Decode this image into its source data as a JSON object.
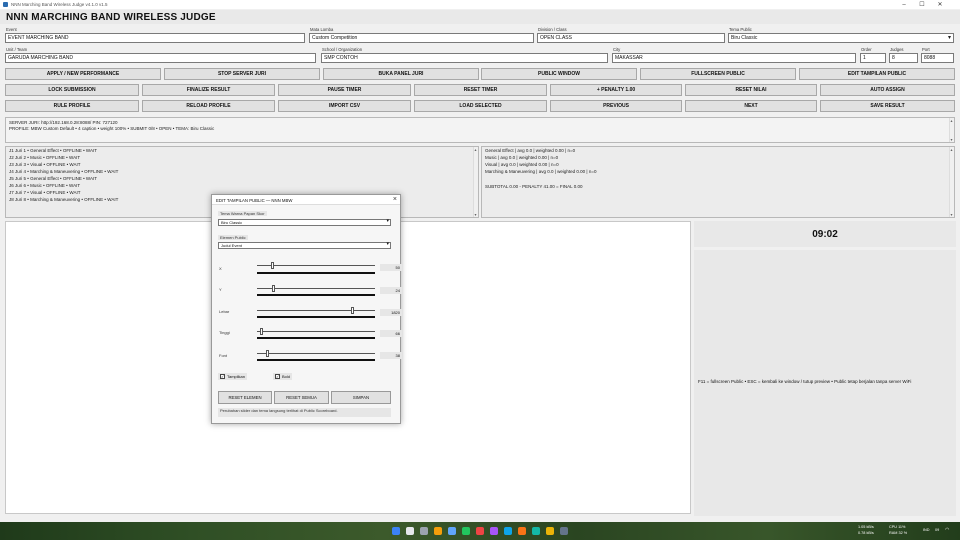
{
  "window": {
    "title": "NNN Marching Band Wireless Judge v4.1.0 v1.5"
  },
  "app_title": "NNN MARCHING BAND WIRELESS JUDGE",
  "form": {
    "event_label": "Event",
    "event_value": "EVENT MARCHING BAND",
    "mata_label": "Mata Lomba",
    "mata_value": "Custom Competition",
    "division_label": "Division / Class",
    "division_value": "OPEN CLASS",
    "tema_label": "Tema Public",
    "tema_value": "Biru Classic",
    "unit_label": "Unit / Team",
    "unit_value": "GARUDA MARCHING BAND",
    "school_label": "School / Organization",
    "school_value": "SMP CONTOH",
    "city_label": "City",
    "city_value": "MAKASSAR",
    "order_label": "Order",
    "order_value": "1",
    "judges_label": "Judges",
    "judges_value": "8",
    "port_label": "Port",
    "port_value": "8088"
  },
  "buttons": {
    "row1": [
      "APPLY / NEW PERFORMANCE",
      "STOP SERVER JURI",
      "BUKA PANEL JURI",
      "PUBLIC WINDOW",
      "FULLSCREEN PUBLIC",
      "EDIT TAMPILAN PUBLIC"
    ],
    "row2": [
      "LOCK SUBMISSION",
      "FINALIZE RESULT",
      "PAUSE TIMER",
      "RESET TIMER",
      "+ PENALTY 1.00",
      "RESET NILAI",
      "AUTO ASSIGN"
    ],
    "row3": [
      "RULE PROFILE",
      "RELOAD PROFILE",
      "IMPORT CSV",
      "LOAD SELECTED",
      "PREVIOUS",
      "NEXT",
      "SAVE RESULT"
    ]
  },
  "status": {
    "line1": "SERVER JURI: http://192.168.0.28:8088/    PIN: 727120",
    "line2": "PROFILE: MBW Custom Default • 4 caption • weight 100%   •   SUBMIT 0/8   •   OPEN   •   TEMA: Biru Classic"
  },
  "judges": [
    "J1  Juri 1  •  General Effect  •  OFFLINE  •  WAIT",
    "J2  Juri 2  •  Music  •  OFFLINE  •  WAIT",
    "J3  Juri 3  •  Visual  •  OFFLINE  •  WAIT",
    "J4  Juri 4  •  Marching & Maneuvering  •  OFFLINE  •  WAIT",
    "J5  Juri 5  •  General Effect  •  OFFLINE  •  WAIT",
    "J6  Juri 6  •  Music  •  OFFLINE  •  WAIT",
    "J7  Juri 7  •  Visual  •  OFFLINE  •  WAIT",
    "J8  Juri 8  •  Marching & Maneuvering  •  OFFLINE  •  WAIT"
  ],
  "scores": [
    "General Effect  |  avg 0.0  |  weighted 0.00  |  n=0",
    "Music  |  avg 0.0  |  weighted 0.00  |  n=0",
    "Visual  |  avg 0.0  |  weighted 0.00  |  n=0",
    "Marching & Maneuvering  |  avg 0.0  |  weighted 0.00  |  n=0",
    "",
    "SUBTOTAL 0.00   -   PENALTY 41.00   =   FINAL 0.00"
  ],
  "timer": "09:02",
  "hint": "F11 = fullscreen Public  •  ESC = kembali ke window / tutup preview  •  Public tetap berjalan tanpa server WiFi",
  "dialog": {
    "title": "EDIT TAMPILAN PUBLIC — NNN MBW",
    "theme_label": "Tema Warna Papan Skor",
    "theme_value": "Biru Classic",
    "element_label": "Elemen Public",
    "element_value": "Judul Event",
    "sliders": [
      {
        "label": "X",
        "value": "50",
        "fraction": 0.12
      },
      {
        "label": "Y",
        "value": "24",
        "fraction": 0.13
      },
      {
        "label": "Lebar",
        "value": "1820",
        "fraction": 0.82
      },
      {
        "label": "Tinggi",
        "value": "66",
        "fraction": 0.03
      },
      {
        "label": "Font",
        "value": "38",
        "fraction": 0.08
      }
    ],
    "chk_tampilkan": "Tampilkan",
    "chk_bold": "Bold",
    "btn_reset_elemen": "RESET ELEMEN",
    "btn_reset_semua": "RESET SEMUA",
    "btn_simpan": "SIMPAN",
    "note": "Perubahan slider dan tema langsung terlihat di Public Scoreboard."
  },
  "tray": {
    "net_up": "1.05 kB/s",
    "net_down": "0.78 kB/s",
    "cpu": "CPU 11%",
    "ram": "RAM 32 %",
    "lang": "IND",
    "clock": "09"
  }
}
